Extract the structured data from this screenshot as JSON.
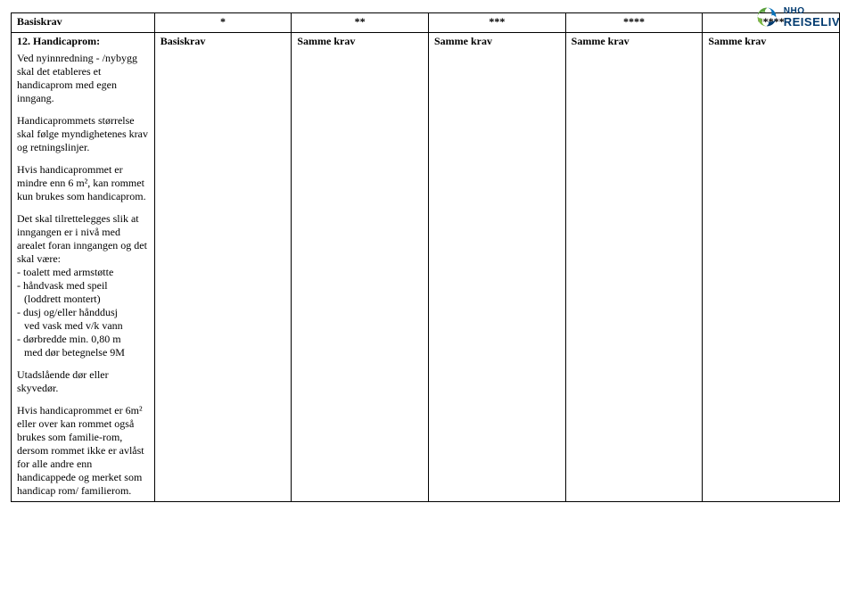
{
  "logo": {
    "line1": "NHO",
    "line2": "REISELIV"
  },
  "table": {
    "headers": [
      "Basiskrav",
      "*",
      "**",
      "***",
      "****",
      "*****"
    ],
    "row": {
      "title": "12. Handicaprom:",
      "stars": [
        "Basiskrav",
        "Samme krav",
        "Samme krav",
        "Samme krav",
        "Samme krav"
      ],
      "body_p1": "Ved nyinnredning - /nybygg skal det etableres et handicaprom med egen inngang.",
      "body_p2": "Handicaprommets størrelse skal følge myndighetenes krav og retningslinjer.",
      "body_p3": "Hvis handicaprommet er mindre enn 6 m², kan rommet kun brukes som handicaprom.",
      "body_p4_intro": "Det skal tilrettelegges slik at inngangen er i nivå med arealet foran inngangen og det skal være:",
      "body_p4_b1": "- toalett med armstøtte",
      "body_p4_b2": "- håndvask med speil",
      "body_p4_b2b": "(loddrett montert)",
      "body_p4_b3": "- dusj og/eller hånddusj",
      "body_p4_b3b": "ved vask med v/k vann",
      "body_p4_b4": "- dørbredde min. 0,80 m",
      "body_p4_b4b": "med dør betegnelse 9M",
      "body_p5": "Utadslående dør eller skyvedør.",
      "body_p6": "Hvis handicaprommet er 6m² eller over kan rommet også brukes som familie-rom, dersom rommet ikke er avlåst for alle andre enn handicappede og merket som handicap rom/ familierom."
    }
  }
}
